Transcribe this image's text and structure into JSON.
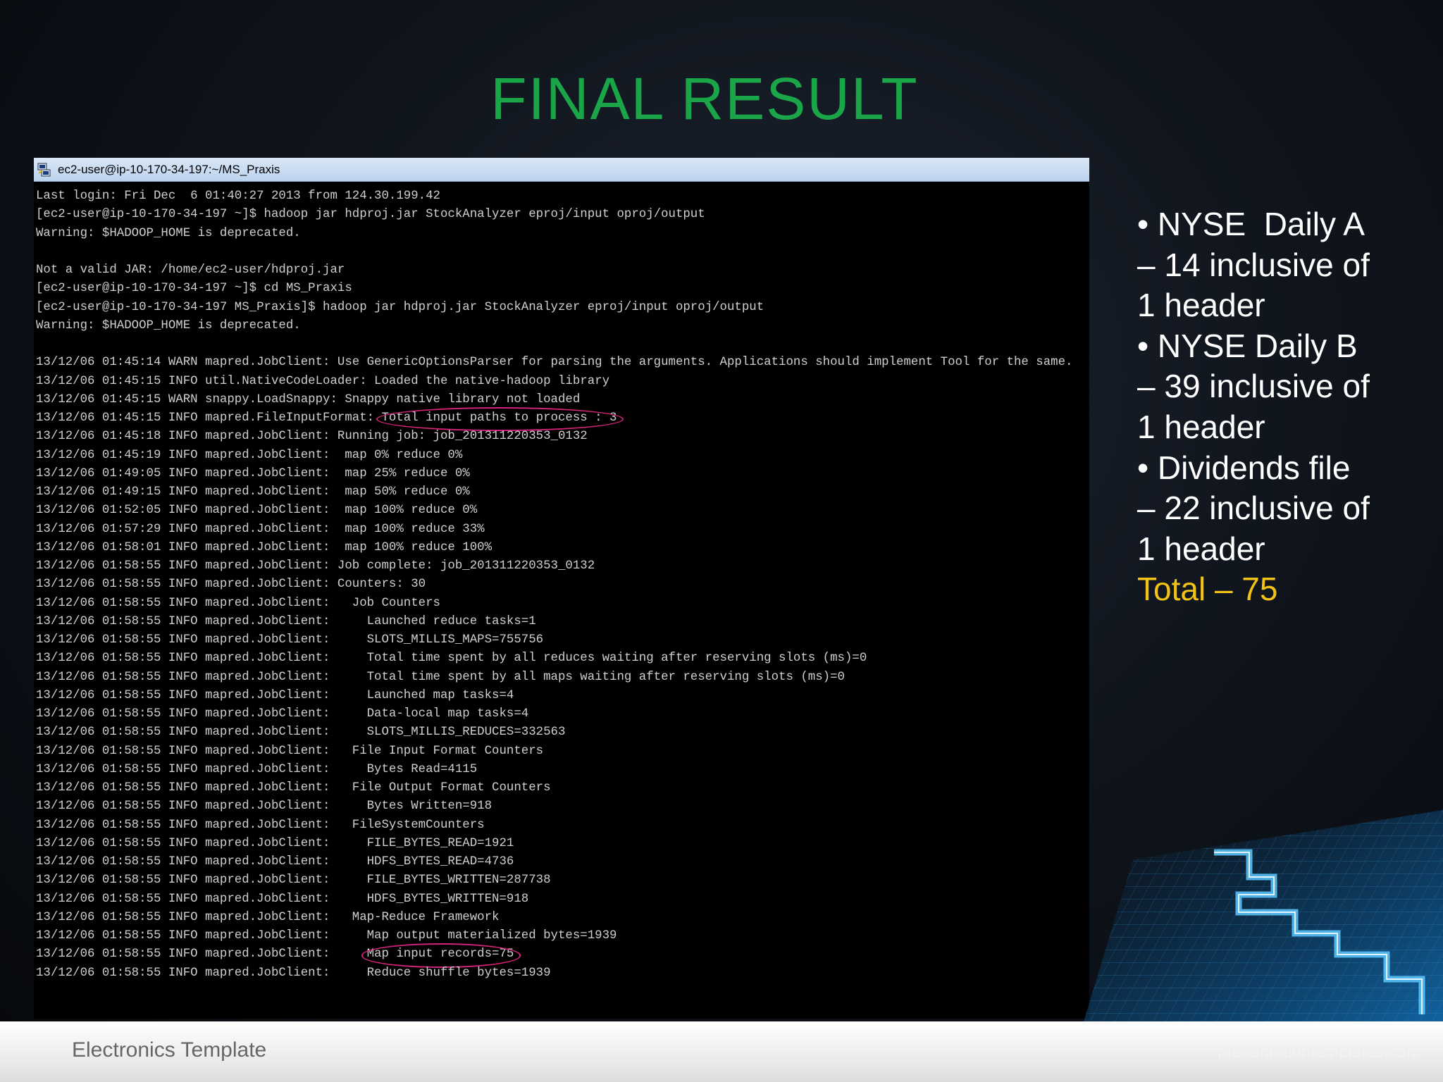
{
  "slide": {
    "title": "FINAL RESULT",
    "footer_text": "Electronics Template",
    "watermark": "presentationtemplates.com"
  },
  "terminal": {
    "window_title": "ec2-user@ip-10-170-34-197:~/MS_Praxis",
    "highlight_color": "#d4237a",
    "lines": [
      {
        "text": "Last login: Fri Dec  6 01:40:27 2013 from 124.30.199.42"
      },
      {
        "text": "[ec2-user@ip-10-170-34-197 ~]$ hadoop jar hdproj.jar StockAnalyzer eproj/input oproj/output"
      },
      {
        "text": "Warning: $HADOOP_HOME is deprecated."
      },
      {
        "text": ""
      },
      {
        "text": "Not a valid JAR: /home/ec2-user/hdproj.jar"
      },
      {
        "text": "[ec2-user@ip-10-170-34-197 ~]$ cd MS_Praxis"
      },
      {
        "text": "[ec2-user@ip-10-170-34-197 MS_Praxis]$ hadoop jar hdproj.jar StockAnalyzer eproj/input oproj/output"
      },
      {
        "text": "Warning: $HADOOP_HOME is deprecated."
      },
      {
        "text": ""
      },
      {
        "text": "13/12/06 01:45:14 WARN mapred.JobClient: Use GenericOptionsParser for parsing the arguments. Applications should implement Tool for the same."
      },
      {
        "text": "13/12/06 01:45:15 INFO util.NativeCodeLoader: Loaded the native-hadoop library"
      },
      {
        "text": "13/12/06 01:45:15 WARN snappy.LoadSnappy: Snappy native library not loaded"
      },
      {
        "prefix": "13/12/06 01:45:15 INFO mapred.FileInputFormat: ",
        "highlight": "Total input paths to process : 3"
      },
      {
        "text": "13/12/06 01:45:18 INFO mapred.JobClient: Running job: job_201311220353_0132"
      },
      {
        "text": "13/12/06 01:45:19 INFO mapred.JobClient:  map 0% reduce 0%"
      },
      {
        "text": "13/12/06 01:49:05 INFO mapred.JobClient:  map 25% reduce 0%"
      },
      {
        "text": "13/12/06 01:49:15 INFO mapred.JobClient:  map 50% reduce 0%"
      },
      {
        "text": "13/12/06 01:52:05 INFO mapred.JobClient:  map 100% reduce 0%"
      },
      {
        "text": "13/12/06 01:57:29 INFO mapred.JobClient:  map 100% reduce 33%"
      },
      {
        "text": "13/12/06 01:58:01 INFO mapred.JobClient:  map 100% reduce 100%"
      },
      {
        "text": "13/12/06 01:58:55 INFO mapred.JobClient: Job complete: job_201311220353_0132"
      },
      {
        "text": "13/12/06 01:58:55 INFO mapred.JobClient: Counters: 30"
      },
      {
        "text": "13/12/06 01:58:55 INFO mapred.JobClient:   Job Counters "
      },
      {
        "text": "13/12/06 01:58:55 INFO mapred.JobClient:     Launched reduce tasks=1"
      },
      {
        "text": "13/12/06 01:58:55 INFO mapred.JobClient:     SLOTS_MILLIS_MAPS=755756"
      },
      {
        "text": "13/12/06 01:58:55 INFO mapred.JobClient:     Total time spent by all reduces waiting after reserving slots (ms)=0"
      },
      {
        "text": "13/12/06 01:58:55 INFO mapred.JobClient:     Total time spent by all maps waiting after reserving slots (ms)=0"
      },
      {
        "text": "13/12/06 01:58:55 INFO mapred.JobClient:     Launched map tasks=4"
      },
      {
        "text": "13/12/06 01:58:55 INFO mapred.JobClient:     Data-local map tasks=4"
      },
      {
        "text": "13/12/06 01:58:55 INFO mapred.JobClient:     SLOTS_MILLIS_REDUCES=332563"
      },
      {
        "text": "13/12/06 01:58:55 INFO mapred.JobClient:   File Input Format Counters "
      },
      {
        "text": "13/12/06 01:58:55 INFO mapred.JobClient:     Bytes Read=4115"
      },
      {
        "text": "13/12/06 01:58:55 INFO mapred.JobClient:   File Output Format Counters "
      },
      {
        "text": "13/12/06 01:58:55 INFO mapred.JobClient:     Bytes Written=918"
      },
      {
        "text": "13/12/06 01:58:55 INFO mapred.JobClient:   FileSystemCounters"
      },
      {
        "text": "13/12/06 01:58:55 INFO mapred.JobClient:     FILE_BYTES_READ=1921"
      },
      {
        "text": "13/12/06 01:58:55 INFO mapred.JobClient:     HDFS_BYTES_READ=4736"
      },
      {
        "text": "13/12/06 01:58:55 INFO mapred.JobClient:     FILE_BYTES_WRITTEN=287738"
      },
      {
        "text": "13/12/06 01:58:55 INFO mapred.JobClient:     HDFS_BYTES_WRITTEN=918"
      },
      {
        "text": "13/12/06 01:58:55 INFO mapred.JobClient:   Map-Reduce Framework"
      },
      {
        "text": "13/12/06 01:58:55 INFO mapred.JobClient:     Map output materialized bytes=1939"
      },
      {
        "prefix": "13/12/06 01:58:55 INFO mapred.JobClient:     ",
        "highlight": "Map input records=75"
      },
      {
        "text": "13/12/06 01:58:55 INFO mapred.JobClient:     Reduce shuffle bytes=1939"
      }
    ]
  },
  "summary": {
    "lines": [
      "• NYSE  Daily A",
      "– 14 inclusive of",
      "1 header",
      "• NYSE Daily B",
      "– 39 inclusive of",
      "1 header",
      "• Dividends file",
      "– 22 inclusive of",
      "1 header"
    ],
    "total": "Total – 75",
    "total_color": "#f2c216"
  }
}
